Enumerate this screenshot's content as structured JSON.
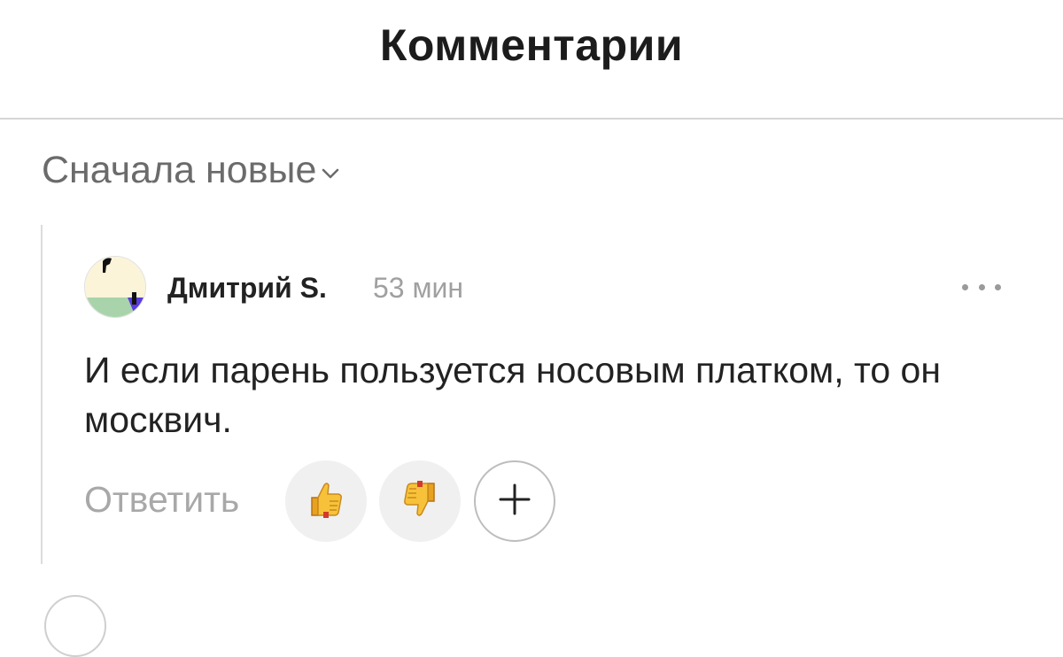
{
  "header": {
    "title": "Комментарии"
  },
  "sort": {
    "label": "Сначала новые",
    "icon": "chevron-down-icon"
  },
  "comment": {
    "author": "Дмитрий S.",
    "time": "53 мин",
    "text": "И если парень пользуется носовым платком, то он москвич.",
    "avatar_colors": [
      "#fbf4d9",
      "#a9d4ab",
      "#5a3ce0",
      "#111111"
    ],
    "more_icon": "more-horizontal-icon"
  },
  "actions": {
    "reply_label": "Ответить",
    "like_icon": "thumbs-up-icon",
    "dislike_icon": "thumbs-down-icon",
    "add_reaction_icon": "plus-icon"
  }
}
